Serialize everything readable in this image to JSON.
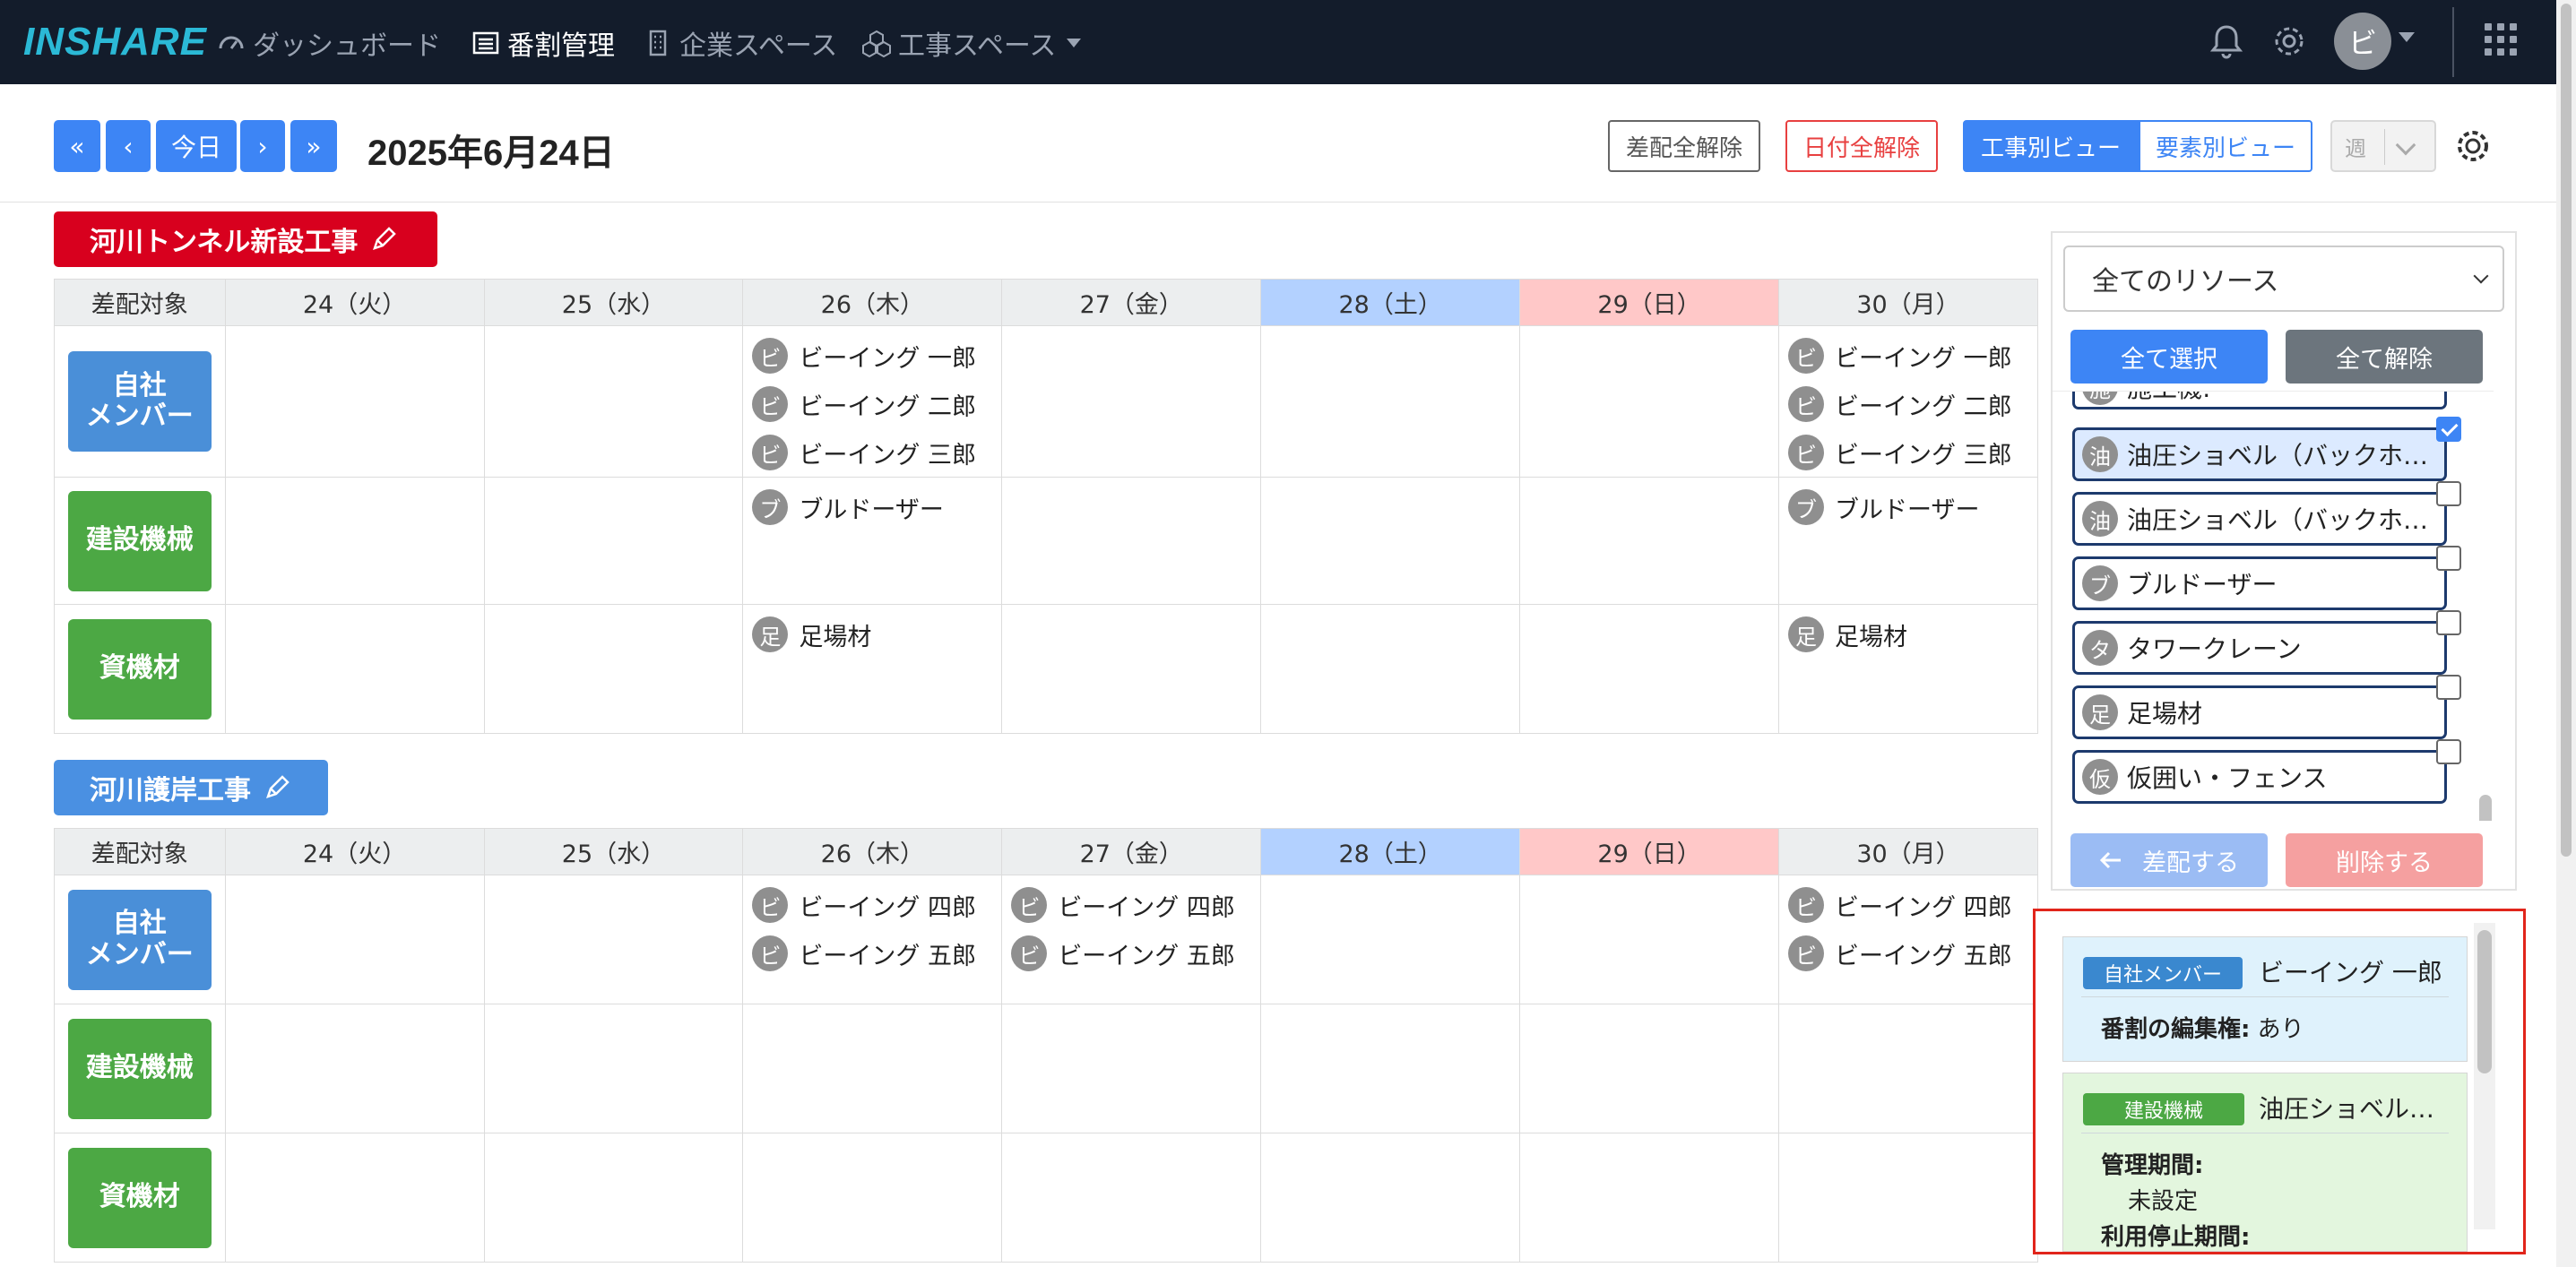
{
  "nav": {
    "logo": "INSHARE",
    "items": [
      {
        "label": "ダッシュボード",
        "icon": "speedometer-icon"
      },
      {
        "label": "番割管理",
        "icon": "list-icon",
        "active": true
      },
      {
        "label": "企業スペース",
        "icon": "building-icon"
      },
      {
        "label": "工事スペース",
        "icon": "boxes-icon"
      }
    ],
    "avatar": "ビ"
  },
  "toolbar": {
    "prev_fast": "«",
    "prev": "‹",
    "today": "今日",
    "next": "›",
    "next_fast": "»",
    "date": "2025年6月24日",
    "clear_assign": "差配全解除",
    "clear_date": "日付全解除",
    "view_project": "工事別ビュー",
    "view_element": "要素別ビュー",
    "period": "週"
  },
  "colors": {
    "accent": "#3d85f5",
    "danger": "#d8001e",
    "member": "#4a8fd8",
    "machine": "#4ca844",
    "saturday": "#b3d1ff",
    "sunday": "#ffc8c8"
  },
  "projects": [
    {
      "name": "河川トンネル新設工事",
      "header": [
        "差配対象",
        "24（火）",
        "25（水）",
        "26（木）",
        "27（金）",
        "28（土）",
        "29（日）",
        "30（月）"
      ],
      "rows": [
        {
          "label": "自社\nメンバー",
          "cells": [
            [],
            [],
            [
              {
                "i": "ビ",
                "t": "ビーイング 一郎"
              },
              {
                "i": "ビ",
                "t": "ビーイング 二郎"
              },
              {
                "i": "ビ",
                "t": "ビーイング 三郎"
              }
            ],
            [],
            [],
            [],
            [
              {
                "i": "ビ",
                "t": "ビーイング 一郎"
              },
              {
                "i": "ビ",
                "t": "ビーイング 二郎"
              },
              {
                "i": "ビ",
                "t": "ビーイング 三郎"
              }
            ]
          ]
        },
        {
          "label": "建設機械",
          "cells": [
            [],
            [],
            [
              {
                "i": "ブ",
                "t": "ブルドーザー"
              }
            ],
            [],
            [],
            [],
            [
              {
                "i": "ブ",
                "t": "ブルドーザー"
              }
            ]
          ]
        },
        {
          "label": "資機材",
          "cells": [
            [],
            [],
            [
              {
                "i": "足",
                "t": "足場材"
              }
            ],
            [],
            [],
            [],
            [
              {
                "i": "足",
                "t": "足場材"
              }
            ]
          ]
        }
      ]
    },
    {
      "name": "河川護岸工事",
      "header": [
        "差配対象",
        "24（火）",
        "25（水）",
        "26（木）",
        "27（金）",
        "28（土）",
        "29（日）",
        "30（月）"
      ],
      "rows": [
        {
          "label": "自社\nメンバー",
          "cells": [
            [],
            [],
            [
              {
                "i": "ビ",
                "t": "ビーイング 四郎"
              },
              {
                "i": "ビ",
                "t": "ビーイング 五郎"
              }
            ],
            [
              {
                "i": "ビ",
                "t": "ビーイング 四郎"
              },
              {
                "i": "ビ",
                "t": "ビーイング 五郎"
              }
            ],
            [],
            [],
            [
              {
                "i": "ビ",
                "t": "ビーイング 四郎"
              },
              {
                "i": "ビ",
                "t": "ビーイング 五郎"
              }
            ]
          ]
        },
        {
          "label": "建設機械",
          "cells": [
            [],
            [],
            [],
            [],
            [],
            [],
            []
          ]
        },
        {
          "label": "資機材",
          "cells": [
            [],
            [],
            [],
            [],
            [],
            [],
            []
          ]
        }
      ]
    }
  ],
  "resource_panel": {
    "filter": "全てのリソース",
    "select_all": "全て選択",
    "deselect_all": "全て解除",
    "partial_item": {
      "icon": "施",
      "label": "施工機:"
    },
    "items": [
      {
        "icon": "油",
        "label": "油圧ショベル（バックホー）",
        "checked": true
      },
      {
        "icon": "油",
        "label": "油圧ショベル（バックホー）",
        "checked": false
      },
      {
        "icon": "ブ",
        "label": "ブルドーザー",
        "checked": false
      },
      {
        "icon": "タ",
        "label": "タワークレーン",
        "checked": false
      },
      {
        "icon": "足",
        "label": "足場材",
        "checked": false
      },
      {
        "icon": "仮",
        "label": "仮囲い・フェンス",
        "checked": false
      }
    ],
    "assign": "差配する",
    "delete": "削除する"
  },
  "details": [
    {
      "tag": "自社メンバー",
      "name": "ビーイング 一郎",
      "field_label": "番割の編集権:",
      "field_value": "あり"
    },
    {
      "tag": "建設機械",
      "name": "油圧ショベル（バックホー）",
      "field_label": "管理期間:",
      "field_value": "未設定",
      "field2_label": "利用停止期間:"
    }
  ]
}
